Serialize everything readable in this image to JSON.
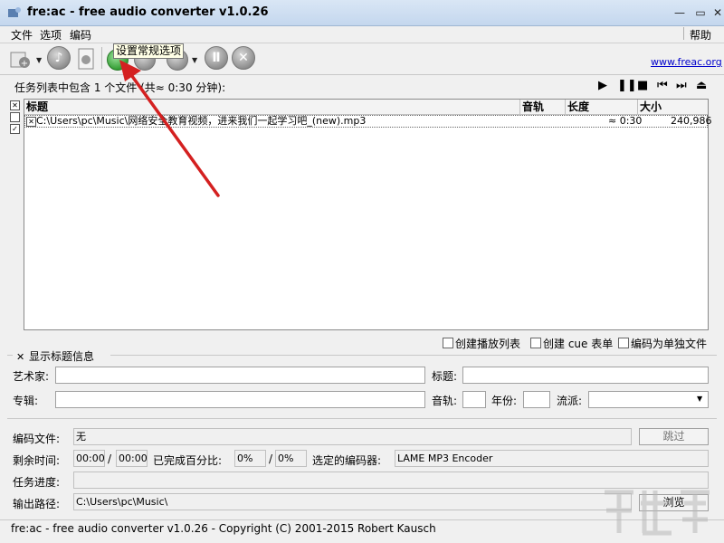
{
  "window": {
    "title": "fre:ac - free audio converter v1.0.26",
    "minimize": "—",
    "close": "✕"
  },
  "menu": {
    "items": [
      "文件",
      "选项",
      "编码"
    ],
    "help": "帮助"
  },
  "toolbar": {
    "tooltip": "设置常规选项",
    "website": "www.freac.org"
  },
  "joblist": {
    "summary": "任务列表中包含 1 个文件 (共≈ 0:30 分钟):",
    "columns": [
      "标题",
      "音轨",
      "长度",
      "大小"
    ],
    "rows": [
      {
        "title": "C:\\Users\\pc\\Music\\网络安全教育视频，进来我们一起学习吧_(new).mp3",
        "track": "",
        "length": "≈ 0:30",
        "size": "240,986"
      }
    ]
  },
  "options": {
    "create_playlist": "创建播放列表",
    "create_cue": "创建 cue 表单",
    "encode_single": "编码为单独文件"
  },
  "tag_info": {
    "show_title_info": "显示标题信息",
    "artist_label": "艺术家:",
    "title_label": "标题:",
    "album_label": "专辑:",
    "track_label": "音轨:",
    "year_label": "年份:",
    "genre_label": "流派:"
  },
  "progress": {
    "encoding_file_label": "编码文件:",
    "encoding_file_value": "无",
    "skip_label": "跳过",
    "remaining_label": "剩余时间:",
    "remaining_value": "00:00",
    "remaining_total": "00:00",
    "slash": "/",
    "percent_label": "已完成百分比:",
    "percent_value": "0%",
    "percent_total": "0%",
    "encoder_label": "选定的编码器:",
    "encoder_value": "LAME MP3 Encoder",
    "job_progress_label": "任务进度:",
    "output_label": "输出路径:",
    "output_value": "C:\\Users\\pc\\Music\\",
    "browse_label": "浏览"
  },
  "status": "fre:ac - free audio converter v1.0.26 - Copyright (C) 2001-2015 Robert Kausch",
  "colors": {
    "annotation_arrow": "#d42020",
    "link": "#0000cc"
  }
}
